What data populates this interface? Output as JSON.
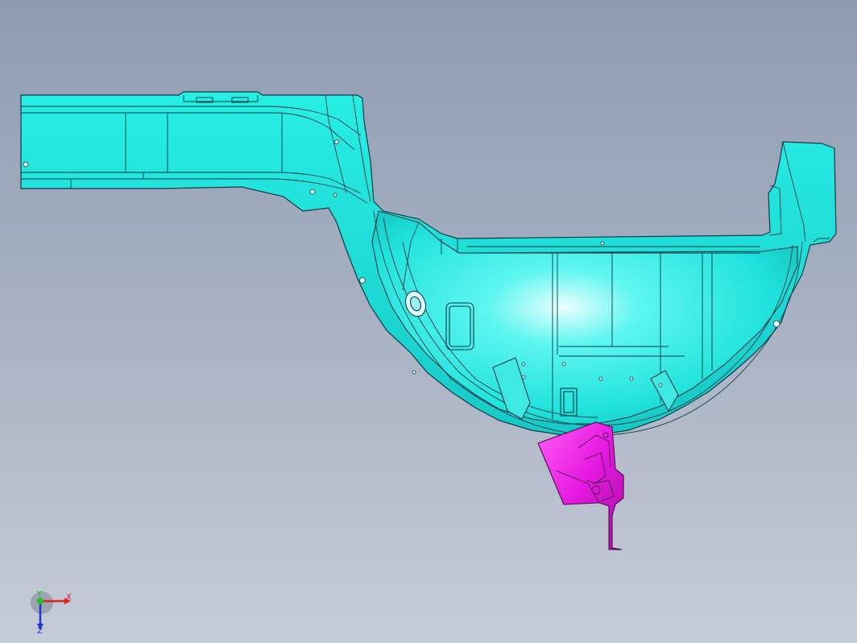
{
  "viewport": {
    "background_top": "#8e9cb2",
    "background_bottom": "#c6ccd8"
  },
  "parts": [
    {
      "name": "floor-rail-assembly",
      "color": "#22e8e0",
      "edge_color": "#0c3b45"
    },
    {
      "name": "bracket",
      "color": "#e619e0",
      "edge_color": "#4a0a48"
    }
  ],
  "triad": {
    "x_label": "X",
    "y_label": "Y",
    "z_label": "Z",
    "x_color": "#e02020",
    "y_color": "#20c020",
    "z_color": "#2030e0"
  }
}
